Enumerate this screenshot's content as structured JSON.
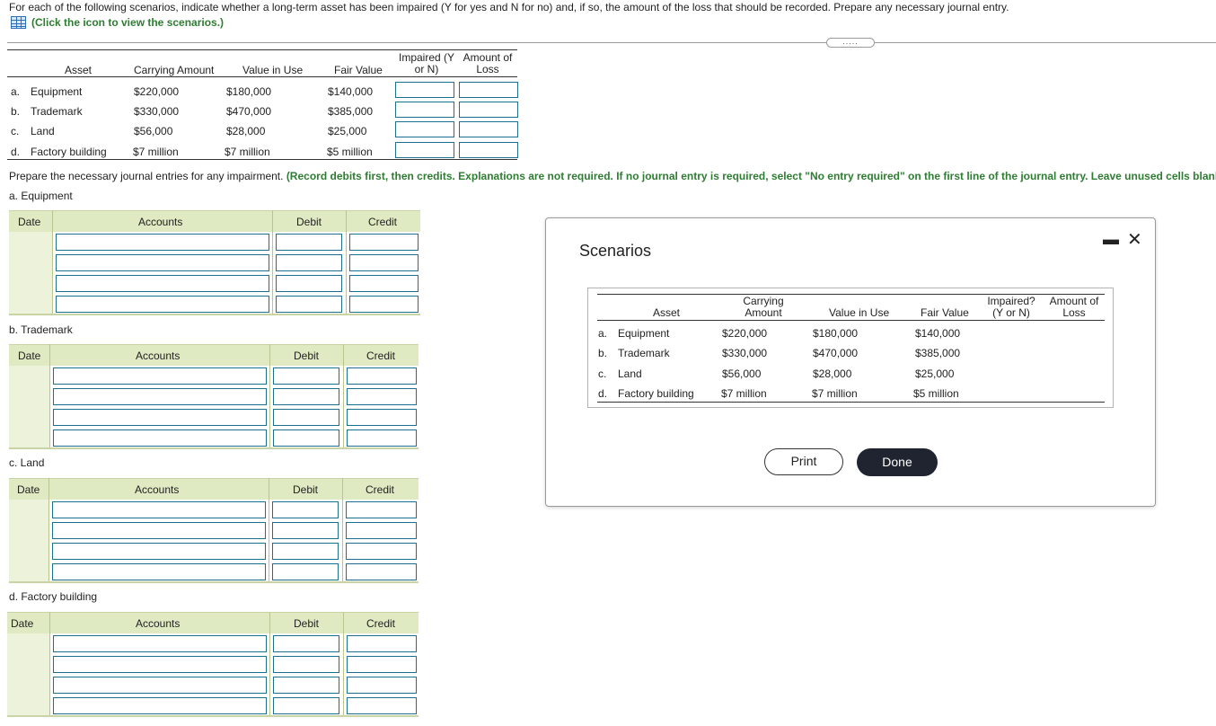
{
  "instructions": "For each of the following scenarios, indicate whether a long-term asset has been impaired (Y for yes and N for no) and, if so, the amount of the loss that should be recorded. Prepare any necessary journal entry.",
  "click_icon_text": "(Click the icon to view the scenarios.)",
  "toggle_dots": ".....",
  "main_table": {
    "headers": {
      "asset": "Asset",
      "carrying": "Carrying Amount",
      "value_in_use": "Value in Use",
      "fair_value": "Fair Value",
      "impaired_l1": "Impaired (Y",
      "impaired_l2": "or N)",
      "loss_l1": "Amount of",
      "loss_l2": "Loss"
    },
    "rows": [
      {
        "letter": "a.",
        "asset": "Equipment",
        "carrying": "$220,000",
        "value_in_use": "$180,000",
        "fair_value": "$140,000"
      },
      {
        "letter": "b.",
        "asset": "Trademark",
        "carrying": "$330,000",
        "value_in_use": "$470,000",
        "fair_value": "$385,000"
      },
      {
        "letter": "c.",
        "asset": "Land",
        "carrying": "$56,000",
        "value_in_use": "$28,000",
        "fair_value": "$25,000"
      },
      {
        "letter": "d.",
        "asset": "Factory building",
        "carrying": "$7 million",
        "value_in_use": "$7 million",
        "fair_value": "$5 million"
      }
    ]
  },
  "prepare": {
    "lead": "Prepare the necessary journal entries for any impairment. ",
    "note": "(Record debits first, then credits. Explanations are not required. If no journal entry is required, select \"No entry required\" on the first line of the journal entry. Leave unused cells blank.)"
  },
  "journal_headers": {
    "date": "Date",
    "accounts": "Accounts",
    "debit": "Debit",
    "credit": "Credit"
  },
  "journals": [
    {
      "label": "a. Equipment"
    },
    {
      "label": "b. Trademark"
    },
    {
      "label": "c. Land"
    },
    {
      "label": "d. Factory building"
    }
  ],
  "modal": {
    "title": "Scenarios",
    "minimize_icon": "minimize-icon",
    "close_icon": "close-icon",
    "headers": {
      "asset": "Asset",
      "carrying_l1": "Carrying",
      "carrying_l2": "Amount",
      "value_in_use": "Value in Use",
      "fair_value": "Fair Value",
      "impaired_l1": "Impaired?",
      "impaired_l2": "(Y or N)",
      "loss_l1": "Amount of",
      "loss_l2": "Loss"
    },
    "print_label": "Print",
    "done_label": "Done"
  }
}
